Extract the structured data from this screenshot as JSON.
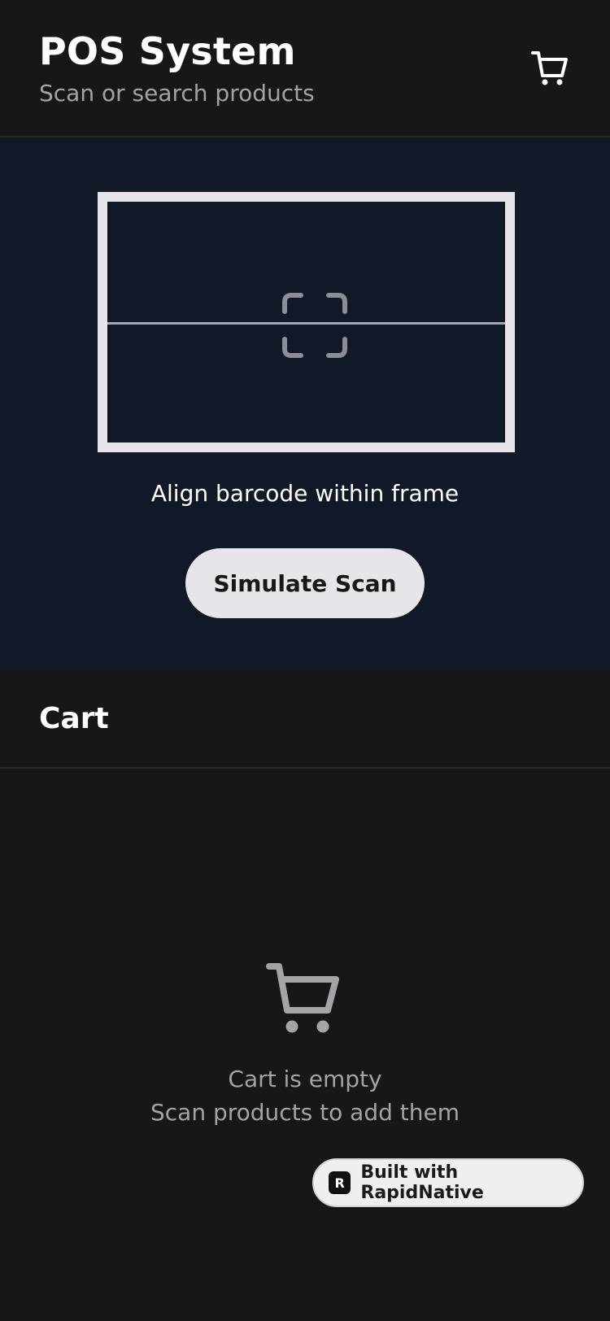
{
  "header": {
    "title": "POS System",
    "subtitle": "Scan or search products",
    "cart_icon": "shopping-cart-icon"
  },
  "scanner": {
    "focus_icon": "scan-focus-icon",
    "hint": "Align barcode within frame",
    "simulate_button": "Simulate Scan"
  },
  "cart": {
    "title": "Cart",
    "empty_icon": "shopping-cart-icon",
    "empty_line1": "Cart is empty",
    "empty_line2": "Scan products to add them"
  },
  "badge": {
    "logo_letter": "R",
    "label": "Built with RapidNative"
  },
  "colors": {
    "background": "#171717",
    "scanner_background": "#111827",
    "frame": "#e5e5ea",
    "muted_text": "#a3a3a3",
    "button_bg": "#e5e5ea"
  }
}
